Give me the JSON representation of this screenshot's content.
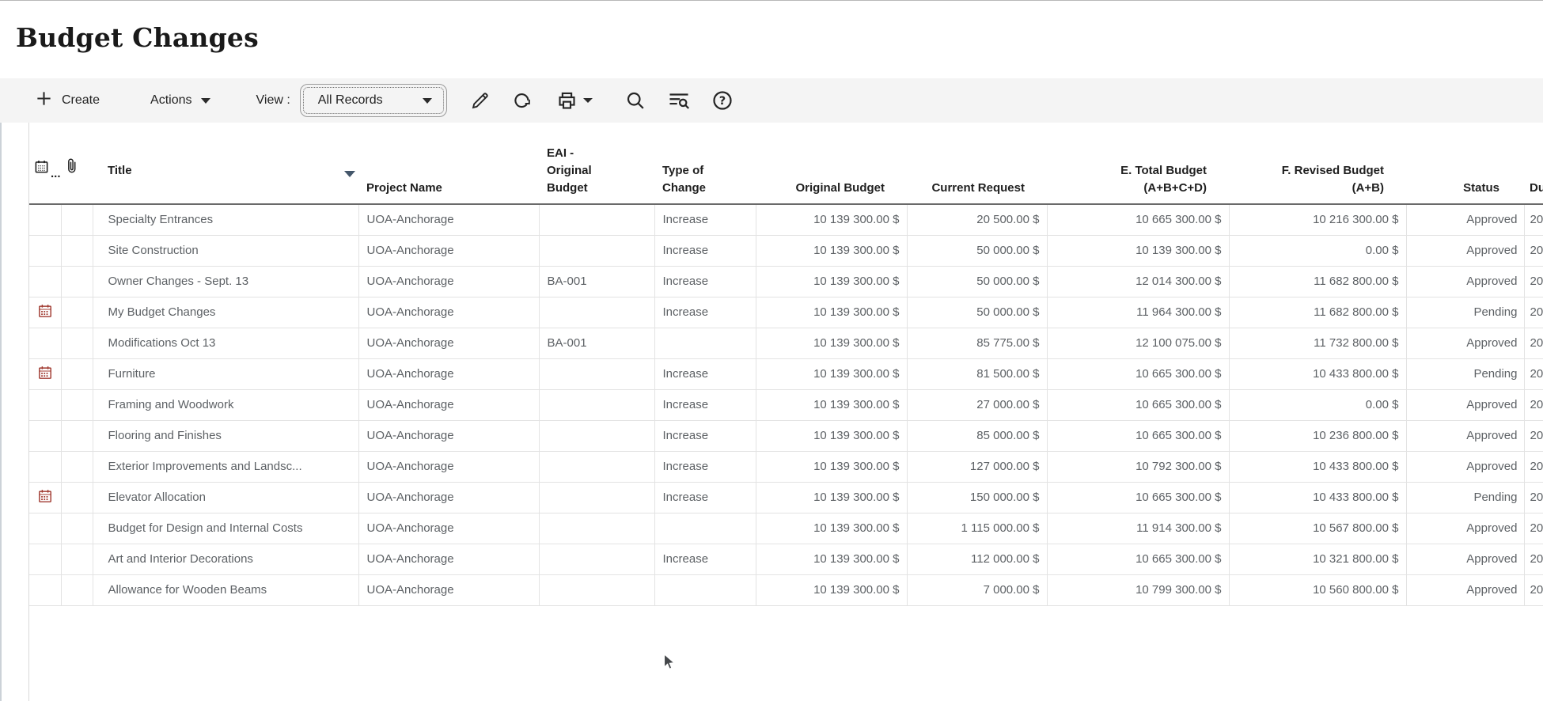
{
  "page": {
    "title": "Budget Changes"
  },
  "toolbar": {
    "create_label": "Create",
    "actions_label": "Actions",
    "view_label": "View :",
    "view_selected": "All Records",
    "icon_names": [
      "edit-pencil-icon",
      "refresh-icon",
      "print-icon",
      "search-icon",
      "find-in-list-icon",
      "help-icon"
    ]
  },
  "table": {
    "headers": {
      "record_icon": "calendar-icon",
      "record_icon_suffix": "...",
      "attachment_icon": "paperclip-icon",
      "title": "Title",
      "project_name": "Project Name",
      "eai_original_budget": "EAI -\nOriginal\nBudget",
      "type_of_change": "Type of\nChange",
      "original_budget": "Original Budget",
      "current_request": "Current Request",
      "e_total_budget": "E. Total Budget\n(A+B+C+D)",
      "f_revised_budget": "F. Revised Budget\n(A+B)",
      "status": "Status",
      "due_truncated": "Du"
    },
    "sort": {
      "column": "Title",
      "direction": "descending-arrow-shown"
    },
    "rows": [
      {
        "flag": false,
        "title": "Specialty Entrances",
        "project": "UOA-Anchorage",
        "eai": "",
        "type": "Increase",
        "original_budget": "10 139 300.00 $",
        "current_request": "20 500.00 $",
        "e_total": "10 665 300.00 $",
        "f_revised": "10 216 300.00 $",
        "status": "Approved",
        "due": "20"
      },
      {
        "flag": false,
        "title": "Site Construction",
        "project": "UOA-Anchorage",
        "eai": "",
        "type": "Increase",
        "original_budget": "10 139 300.00 $",
        "current_request": "50 000.00 $",
        "e_total": "10 139 300.00 $",
        "f_revised": "0.00 $",
        "status": "Approved",
        "due": "20"
      },
      {
        "flag": false,
        "title": "Owner Changes - Sept. 13",
        "project": "UOA-Anchorage",
        "eai": "BA-001",
        "type": "Increase",
        "original_budget": "10 139 300.00 $",
        "current_request": "50 000.00 $",
        "e_total": "12 014 300.00 $",
        "f_revised": "11 682 800.00 $",
        "status": "Approved",
        "due": "20"
      },
      {
        "flag": true,
        "title": "My Budget Changes",
        "project": "UOA-Anchorage",
        "eai": "",
        "type": "Increase",
        "original_budget": "10 139 300.00 $",
        "current_request": "50 000.00 $",
        "e_total": "11 964 300.00 $",
        "f_revised": "11 682 800.00 $",
        "status": "Pending",
        "due": "20"
      },
      {
        "flag": false,
        "title": "Modifications Oct 13",
        "project": "UOA-Anchorage",
        "eai": "BA-001",
        "type": "",
        "original_budget": "10 139 300.00 $",
        "current_request": "85 775.00 $",
        "e_total": "12 100 075.00 $",
        "f_revised": "11 732 800.00 $",
        "status": "Approved",
        "due": "20"
      },
      {
        "flag": true,
        "title": "Furniture",
        "project": "UOA-Anchorage",
        "eai": "",
        "type": "Increase",
        "original_budget": "10 139 300.00 $",
        "current_request": "81 500.00 $",
        "e_total": "10 665 300.00 $",
        "f_revised": "10 433 800.00 $",
        "status": "Pending",
        "due": "20"
      },
      {
        "flag": false,
        "title": "Framing and Woodwork",
        "project": "UOA-Anchorage",
        "eai": "",
        "type": "Increase",
        "original_budget": "10 139 300.00 $",
        "current_request": "27 000.00 $",
        "e_total": "10 665 300.00 $",
        "f_revised": "0.00 $",
        "status": "Approved",
        "due": "20"
      },
      {
        "flag": false,
        "title": "Flooring and Finishes",
        "project": "UOA-Anchorage",
        "eai": "",
        "type": "Increase",
        "original_budget": "10 139 300.00 $",
        "current_request": "85 000.00 $",
        "e_total": "10 665 300.00 $",
        "f_revised": "10 236 800.00 $",
        "status": "Approved",
        "due": "20"
      },
      {
        "flag": false,
        "title": "Exterior Improvements and Landsc...",
        "project": "UOA-Anchorage",
        "eai": "",
        "type": "Increase",
        "original_budget": "10 139 300.00 $",
        "current_request": "127 000.00 $",
        "e_total": "10 792 300.00 $",
        "f_revised": "10 433 800.00 $",
        "status": "Approved",
        "due": "20"
      },
      {
        "flag": true,
        "title": "Elevator Allocation",
        "project": "UOA-Anchorage",
        "eai": "",
        "type": "Increase",
        "original_budget": "10 139 300.00 $",
        "current_request": "150 000.00 $",
        "e_total": "10 665 300.00 $",
        "f_revised": "10 433 800.00 $",
        "status": "Pending",
        "due": "20"
      },
      {
        "flag": false,
        "title": "Budget for Design and Internal Costs",
        "project": "UOA-Anchorage",
        "eai": "",
        "type": "",
        "original_budget": "10 139 300.00 $",
        "current_request": "1 115 000.00 $",
        "e_total": "11 914 300.00 $",
        "f_revised": "10 567 800.00 $",
        "status": "Approved",
        "due": "20"
      },
      {
        "flag": false,
        "title": "Art and Interior Decorations",
        "project": "UOA-Anchorage",
        "eai": "",
        "type": "Increase",
        "original_budget": "10 139 300.00 $",
        "current_request": "112 000.00 $",
        "e_total": "10 665 300.00 $",
        "f_revised": "10 321 800.00 $",
        "status": "Approved",
        "due": "20"
      },
      {
        "flag": false,
        "title": "Allowance for Wooden Beams",
        "project": "UOA-Anchorage",
        "eai": "",
        "type": "",
        "original_budget": "10 139 300.00 $",
        "current_request": "7 000.00 $",
        "e_total": "10 799 300.00 $",
        "f_revised": "10 560 800.00 $",
        "status": "Approved",
        "due": "20"
      }
    ]
  },
  "colors": {
    "toolbar_bg": "#f4f4f4",
    "flag_red": "#a03a30",
    "header_text": "#1f1f1f",
    "cell_text": "#5d6165",
    "grid_line": "#e3e3e3",
    "sort_arrow": "#44576b"
  }
}
